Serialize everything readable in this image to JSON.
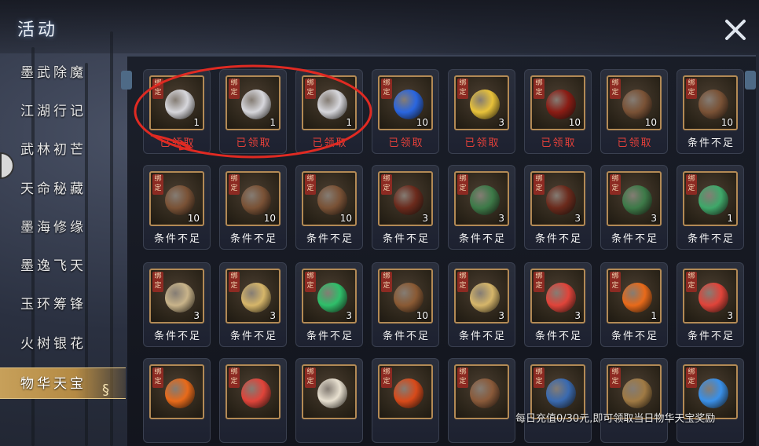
{
  "header": {
    "title": "活动"
  },
  "sidebar": {
    "items": [
      {
        "label": "墨武除魔",
        "active": false
      },
      {
        "label": "江湖行记",
        "active": false
      },
      {
        "label": "武林初芒",
        "active": false
      },
      {
        "label": "天命秘藏",
        "active": false
      },
      {
        "label": "墨海修缘",
        "active": false
      },
      {
        "label": "墨逸飞天",
        "active": false
      },
      {
        "label": "玉环筹锋",
        "active": false
      },
      {
        "label": "火树银花",
        "active": false
      },
      {
        "label": "物华天宝",
        "active": true
      }
    ]
  },
  "bind_tag": "绑定",
  "rows": [
    [
      {
        "icon": "silver-medal-icon",
        "color": "#d7d7dc",
        "count": "1",
        "status": "已领取",
        "state": "claimed"
      },
      {
        "icon": "silver-medal-icon",
        "color": "#d7d7dc",
        "count": "1",
        "status": "已领取",
        "state": "claimed"
      },
      {
        "icon": "silver-medal-icon",
        "color": "#d7d7dc",
        "count": "1",
        "status": "已领取",
        "state": "claimed"
      },
      {
        "icon": "blue-orb-icon",
        "color": "#2a66e0",
        "count": "10",
        "status": "已领取",
        "state": "claimed"
      },
      {
        "icon": "gold-star-icon",
        "color": "#e8c23a",
        "count": "3",
        "status": "已领取",
        "state": "claimed"
      },
      {
        "icon": "red-book-icon",
        "color": "#8a1c14",
        "count": "10",
        "status": "已领取",
        "state": "claimed"
      },
      {
        "icon": "paw-icon",
        "color": "#7a5236",
        "count": "10",
        "status": "已领取",
        "state": "claimed"
      },
      {
        "icon": "paw-icon",
        "color": "#7a5236",
        "count": "10",
        "status": "条件不足",
        "state": "locked"
      }
    ],
    [
      {
        "icon": "paw-icon",
        "color": "#7a5236",
        "count": "10",
        "status": "条件不足",
        "state": "locked"
      },
      {
        "icon": "paw-icon",
        "color": "#7a5236",
        "count": "10",
        "status": "条件不足",
        "state": "locked"
      },
      {
        "icon": "paw-icon",
        "color": "#7a5236",
        "count": "10",
        "status": "条件不足",
        "state": "locked"
      },
      {
        "icon": "wine-jar-icon",
        "color": "#6b2a1c",
        "count": "3",
        "status": "条件不足",
        "state": "locked"
      },
      {
        "icon": "scroll-bottle-icon",
        "color": "#3d7a48",
        "count": "3",
        "status": "条件不足",
        "state": "locked"
      },
      {
        "icon": "wine-jar-icon",
        "color": "#6b2a1c",
        "count": "3",
        "status": "条件不足",
        "state": "locked"
      },
      {
        "icon": "scroll-bottle-icon",
        "color": "#3d7a48",
        "count": "3",
        "status": "条件不足",
        "state": "locked"
      },
      {
        "icon": "jade-token-icon",
        "color": "#3fa86a",
        "count": "1",
        "status": "条件不足",
        "state": "locked"
      }
    ],
    [
      {
        "icon": "map-scroll-icon",
        "color": "#c9b48a",
        "count": "3",
        "status": "条件不足",
        "state": "locked"
      },
      {
        "icon": "magic-scroll-icon",
        "color": "#d6b66a",
        "count": "3",
        "status": "条件不足",
        "state": "locked"
      },
      {
        "icon": "green-swirl-icon",
        "color": "#2fbf6a",
        "count": "3",
        "status": "条件不足",
        "state": "locked"
      },
      {
        "icon": "talisman-icon",
        "color": "#8a5a34",
        "count": "10",
        "status": "条件不足",
        "state": "locked"
      },
      {
        "icon": "magic-scroll-icon",
        "color": "#d6b66a",
        "count": "3",
        "status": "条件不足",
        "state": "locked"
      },
      {
        "icon": "red-swirl-icon",
        "color": "#e0443a",
        "count": "3",
        "status": "条件不足",
        "state": "locked"
      },
      {
        "icon": "fire-gem-icon",
        "color": "#e86a1a",
        "count": "1",
        "status": "条件不足",
        "state": "locked"
      },
      {
        "icon": "red-swirl-icon",
        "color": "#e0443a",
        "count": "3",
        "status": "条件不足",
        "state": "locked"
      }
    ],
    [
      {
        "icon": "fire-gem-icon",
        "color": "#e86a1a",
        "count": "",
        "status": "",
        "state": "locked"
      },
      {
        "icon": "red-swirl-icon",
        "color": "#e0443a",
        "count": "",
        "status": "",
        "state": "locked"
      },
      {
        "icon": "gourd-icon",
        "color": "#e8e0d0",
        "count": "",
        "status": "",
        "state": "locked"
      },
      {
        "icon": "orb-plate-icon",
        "color": "#d84a1a",
        "count": "",
        "status": "",
        "state": "locked"
      },
      {
        "icon": "potion-icon",
        "color": "#8a5a3a",
        "count": "",
        "status": "",
        "state": "locked"
      },
      {
        "icon": "blue-vase-icon",
        "color": "#3a6ab0",
        "count": "",
        "status": "",
        "state": "locked"
      },
      {
        "icon": "bronze-box-icon",
        "color": "#a07a44",
        "count": "",
        "status": "",
        "state": "locked"
      },
      {
        "icon": "blue-crystal-icon",
        "color": "#3a90e8",
        "count": "",
        "status": "",
        "state": "locked"
      }
    ]
  ],
  "footer": {
    "text": "每日充值0/30元,即可领取当日物华天宝奖励"
  },
  "colors": {
    "claimed": "#e2403a",
    "locked": "#f2f2f2",
    "frame": "#b38a55",
    "active_tab": "#c7a05a"
  }
}
